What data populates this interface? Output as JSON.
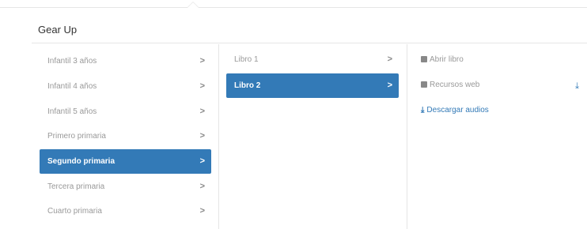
{
  "header": {
    "title": "Gear Up"
  },
  "levels": [
    {
      "label": "Infantil 3 años",
      "chevron": ">"
    },
    {
      "label": "Infantil 4 años",
      "chevron": ">"
    },
    {
      "label": "Infantil 5 años",
      "chevron": ">"
    },
    {
      "label": "Primero primaria",
      "chevron": ">"
    },
    {
      "label": "Segundo primaria",
      "chevron": ">"
    },
    {
      "label": "Tercera primaria",
      "chevron": ">"
    },
    {
      "label": "Cuarto primaria",
      "chevron": ">"
    }
  ],
  "books": [
    {
      "label": "Libro 1",
      "chevron": ">"
    },
    {
      "label": "Libro 2",
      "chevron": ">"
    }
  ],
  "resources": {
    "open_book": "Abrir libro",
    "web_resources": "Recursos web",
    "download_audios": "Descargar audios"
  },
  "colors": {
    "accent": "#337ab7",
    "muted_text": "#999999"
  }
}
